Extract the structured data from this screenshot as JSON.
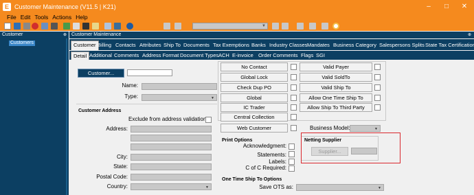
{
  "window": {
    "title": "Customer Maintenance (V11.5 | K21)",
    "app_icon": "E",
    "minimize_glyph": "–",
    "maximize_glyph": "□",
    "close_glyph": "✕",
    "accent_color": "#f58a1e"
  },
  "menu": [
    "File",
    "Edit",
    "Tools",
    "Actions",
    "Help"
  ],
  "toolbar": {
    "icons": [
      "new-icon",
      "save-icon",
      "undo-icon",
      "delete-icon",
      "open-icon",
      "print-icon",
      "refresh-icon",
      "copy-icon",
      "cut-icon",
      "paste-icon",
      "find-icon",
      "search-icon",
      "help-icon",
      "first-icon",
      "previous-icon",
      "key-combo",
      "next-icon",
      "last-icon",
      "browse-icon",
      "close-icon"
    ]
  },
  "left_panel": {
    "header": "Customer",
    "pin_glyph": "⊕",
    "tree_items": [
      "Customers"
    ]
  },
  "main": {
    "header": "Customer Maintenance",
    "pin_glyph": "⊕",
    "tabs": [
      "Customer",
      "Billing",
      "Contacts",
      "Attributes",
      "Ship To",
      "Documents",
      "Tax Exemptions",
      "Banks",
      "Industry Classes",
      "Mandates",
      "Business Category",
      "Salespersons Splits",
      "State Tax Certification"
    ],
    "active_tab": "Customer",
    "subtabs": [
      "Detail",
      "Additional",
      "Comments",
      "Address Format",
      "Document Types",
      "ACH",
      "E-invoice",
      "Order Comments",
      "Flags",
      "SGI"
    ],
    "active_subtab": "Detail"
  },
  "customer_block": {
    "customer_button": "Customer...",
    "customer_value": "",
    "name_label": "Name:",
    "name_value": "",
    "type_label": "Type:",
    "type_value": ""
  },
  "address": {
    "section_title": "Customer Address",
    "exclude_label": "Exclude from address validation:",
    "address_label": "Address:",
    "city_label": "City:",
    "state_label": "State:",
    "postal_label": "Postal Code:",
    "country_label": "Country:"
  },
  "actions": {
    "no_contact": "No Contact",
    "global_lock": "Global Lock",
    "check_dup_po": "Check Dup PO",
    "global": "Global",
    "ic_trader": "IC Trader",
    "central_collection": "Central Collection",
    "valid_payer": "Valid Payer",
    "valid_soldto": "Valid SoldTo",
    "valid_shipto": "Valid Ship To",
    "allow_one_time": "Allow One Time Ship To",
    "allow_third_party": "Allow Ship To Third Party",
    "web_customer": "Web Customer",
    "business_model_label": "Business Model:",
    "business_model_value": ""
  },
  "print_options": {
    "title": "Print Options",
    "acknowledgment": "Acknowledgment:",
    "statements": "Statements:",
    "labels": "Labels:",
    "coc_required": "C of C Required:"
  },
  "netting": {
    "title": "Netting Supplier",
    "supplier_button": "Supplier...",
    "supplier_value": "",
    "highlight_color": "#d9262c"
  },
  "one_time": {
    "title": "One Time Ship To Options",
    "save_ots_label": "Save OTS as:",
    "save_ots_value": ""
  }
}
